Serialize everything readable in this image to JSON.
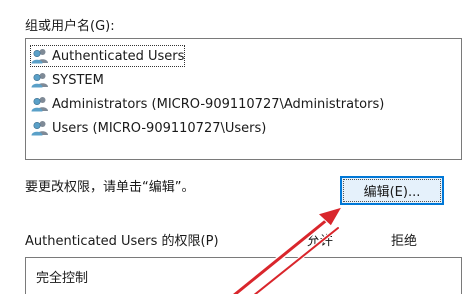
{
  "group_label": "组或用户名(G):",
  "users": [
    {
      "name": "Authenticated Users",
      "icon": "users-group-icon"
    },
    {
      "name": "SYSTEM",
      "icon": "users-group-icon"
    },
    {
      "name": "Administrators (MICRO-909110727\\Administrators)",
      "icon": "users-group-icon"
    },
    {
      "name": "Users (MICRO-909110727\\Users)",
      "icon": "users-group-icon"
    }
  ],
  "selected_user_index": 0,
  "change_hint": "要更改权限，请单击“编辑”。",
  "edit_button_label": "编辑(E)...",
  "permissions": {
    "label": "Authenticated Users 的权限(P)",
    "allow_header": "允许",
    "deny_header": "拒绝",
    "rows": [
      "完全控制"
    ]
  },
  "colors": {
    "arrow": "#d9262c",
    "button_border": "#0078d7",
    "button_bg": "#e5f1fb"
  }
}
